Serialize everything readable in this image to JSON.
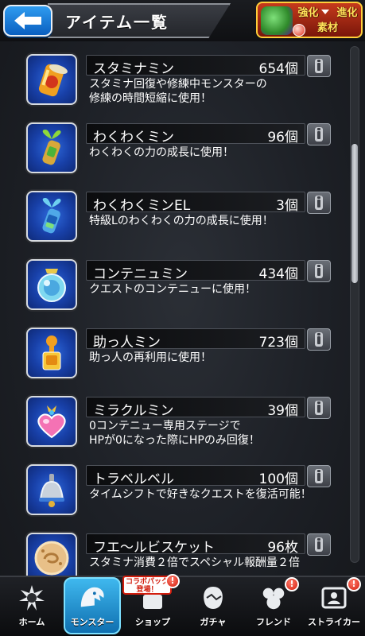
{
  "header": {
    "title": "アイテム一覧",
    "evolve_button": {
      "line1": "強化",
      "line2": "進化",
      "line3": "素材"
    }
  },
  "items": [
    {
      "name": "スタミナミン",
      "count": "654個",
      "desc": "スタミナ回復や修練中モンスターの\n修練の時間短縮に使用！",
      "icon": "stamina-can-icon"
    },
    {
      "name": "わくわくミン",
      "count": "96個",
      "desc": "わくわくの力の成長に使用！",
      "icon": "sprout-bottle-icon"
    },
    {
      "name": "わくわくミンEL",
      "count": "3個",
      "desc": "特級Lのわくわくの力の成長に使用！",
      "icon": "el-bottle-icon"
    },
    {
      "name": "コンテニュミン",
      "count": "434個",
      "desc": "クエストのコンテニューに使用！",
      "icon": "continue-flask-icon"
    },
    {
      "name": "助っ人ミン",
      "count": "723個",
      "desc": "助っ人の再利用に使用！",
      "icon": "helper-bottle-icon"
    },
    {
      "name": "ミラクルミン",
      "count": "39個",
      "desc": "0コンテニュー専用ステージで\nHPが0になった際にHPのみ回復！",
      "icon": "miracle-heart-icon"
    },
    {
      "name": "トラベルベル",
      "count": "100個",
      "desc": "タイムシフトで好きなクエストを復活可能！",
      "icon": "travel-bell-icon"
    },
    {
      "name": "フエ～ルビスケット",
      "count": "96枚",
      "desc": "スタミナ消費２倍でスペシャル報酬量２倍",
      "icon": "biscuit-icon"
    }
  ],
  "nav": {
    "items": [
      {
        "label": "ホーム",
        "icon": "home-icon"
      },
      {
        "label": "モンスター",
        "icon": "monster-icon"
      },
      {
        "label": "ショップ",
        "icon": "shop-icon"
      },
      {
        "label": "ガチャ",
        "icon": "gacha-icon"
      },
      {
        "label": "フレンド",
        "icon": "friend-icon"
      },
      {
        "label": "ストライカー",
        "icon": "striker-icon"
      }
    ],
    "collab_tag": "コラボパック\n登場！",
    "badge": "!"
  },
  "colors": {
    "accent": "#1aa3e8",
    "icon_bg": "#1840a8",
    "badge": "#d21d0d"
  }
}
